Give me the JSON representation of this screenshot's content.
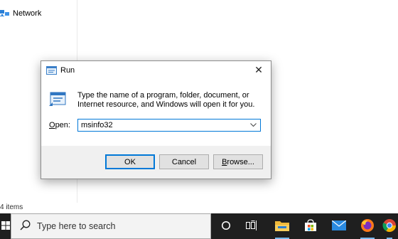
{
  "explorer": {
    "nav_network": "Network",
    "status_items": "4 items"
  },
  "dialog": {
    "title": "Run",
    "description": "Type the name of a program, folder, document, or Internet resource, and Windows will open it for you.",
    "open_label_underlined": "O",
    "open_label_rest": "pen:",
    "input_value": "msinfo32",
    "ok_label": "OK",
    "cancel_label": "Cancel",
    "browse_label_underlined": "B",
    "browse_label_rest": "rowse...",
    "close_glyph": "✕"
  },
  "taskbar": {
    "search_placeholder": "Type here to search",
    "icons": [
      "start-windows-icon",
      "cortana-icon",
      "task-view-icon",
      "file-explorer-icon",
      "microsoft-store-icon",
      "mail-icon",
      "firefox-icon",
      "chrome-icon"
    ]
  },
  "colors": {
    "accent": "#0078d7",
    "taskbar": "#1f1f1f",
    "dialog_bg": "#f0f0f0"
  }
}
